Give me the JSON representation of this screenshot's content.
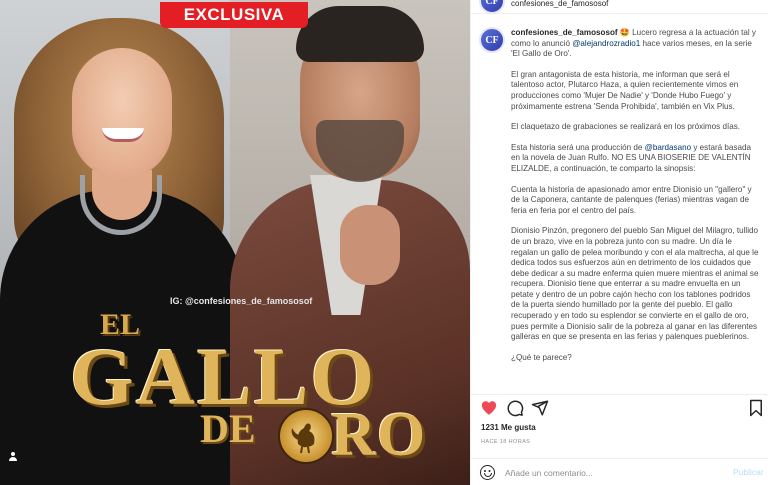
{
  "post": {
    "image": {
      "banner": "EXCLUSIVA",
      "watermark": "IG: @confesiones_de_famososof",
      "logo": {
        "el": "EL",
        "gallo": "GALLO",
        "de": "DE",
        "oro": "ORO"
      }
    }
  },
  "header": {
    "username": "confesiones_de_famososof",
    "avatar_initials": "CF"
  },
  "caption": {
    "username": "confesiones_de_famososof",
    "p1_a": "🤩 Lucero regresa a la actuación tal y como lo anunció ",
    "p1_mention": "@alejandrozradio1",
    "p1_b": " hace varios meses, en la serie 'El Gallo de Oro'.",
    "p2": "El gran antagonista de esta historia, me informan que será el talentoso actor, Plutarco Haza, a quien recientemente vimos en producciones como 'Mujer De Nadie' y 'Donde Hubo Fuego' y próximamente estrena 'Senda Prohibida', también en Vix Plus.",
    "p3": "El claquetazo de grabaciones se realizará en los próximos días.",
    "p4_a": "Esta historia será una producción de ",
    "p4_mention": "@bardasano",
    "p4_b": " y estará basada en la novela de Juan Rulfo. NO ES UNA BIOSERIE DE VALENTÍN ELIZALDE, a continuación, te comparto la sinopsis:",
    "p5": "Cuenta la historia de apasionado amor entre Dionisio un \"gallero\" y de la Caponera, cantante de palenques (ferias) mientras vagan de feria en feria por el centro del país.",
    "p6": "Dionisio Pinzón, pregonero del pueblo San Miguel del Milagro, tullido de un brazo, vive en la pobreza junto con su madre. Un día le regalan un gallo de pelea moribundo y con el ala maltrecha, al que le dedica todos sus esfuerzos aún en detrimento de los cuidados que debe dedicar a su madre enferma quien muere mientras el animal se recupera. Dionisio tiene que enterrar a su madre envuelta en un petate y dentro de un pobre cajón hecho con los tablones podridos de la puerta siendo humillado por la gente del pueblo. El gallo recuperado y en todo su esplendor se convierte en el gallo de oro, pues permite a Dionisio salir de la pobreza al ganar en las diferentes galleras en que se presenta en las ferias y palenques pueblerinos.",
    "p7": "¿Qué te parece?"
  },
  "actions": {
    "like_icon": "heart-icon",
    "comment_icon": "comment-bubble-icon",
    "share_icon": "paper-plane-icon",
    "save_icon": "bookmark-icon",
    "like_color": "#ed4956"
  },
  "likes": "1231 Me gusta",
  "timestamp": "HACE 18 HORAS",
  "comment": {
    "placeholder": "Añade un comentario...",
    "publish_label": "Publicar"
  }
}
